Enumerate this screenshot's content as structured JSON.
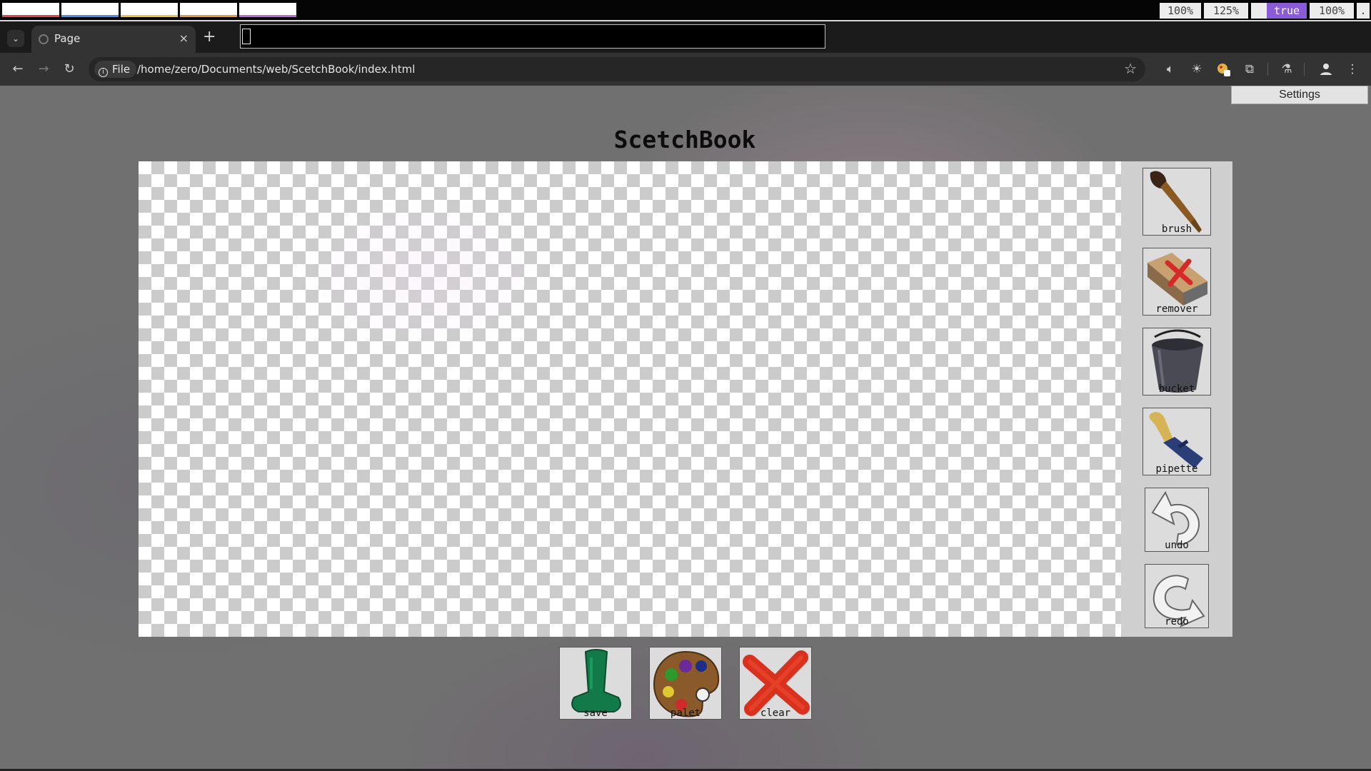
{
  "system_bar": {
    "workspace_colors": [
      "#e04646",
      "#4a8fe6",
      "#e8c53a",
      "#e89a3a",
      "#b56ad6"
    ],
    "status": [
      "100%",
      "125%",
      "",
      "true",
      "100%",
      "."
    ]
  },
  "browser": {
    "tab": {
      "title": "Page",
      "close": "×"
    },
    "new_tab": "+",
    "address": {
      "scheme_label": "File",
      "url": "/home/zero/Documents/web/ScetchBook/index.html"
    }
  },
  "app": {
    "settings_label": "Settings",
    "title": "ScetchBook",
    "tools": {
      "brush": "brush",
      "remover": "remover",
      "bucket": "bucket",
      "pipette": "pipette",
      "undo": "undo",
      "redo": "redo"
    },
    "actions": {
      "save": "save",
      "palet": "palet",
      "clear": "clear"
    }
  },
  "colors": {
    "accent": "#8a5bd6",
    "save_icon": "#127a48",
    "clear_icon": "#d8321e"
  }
}
